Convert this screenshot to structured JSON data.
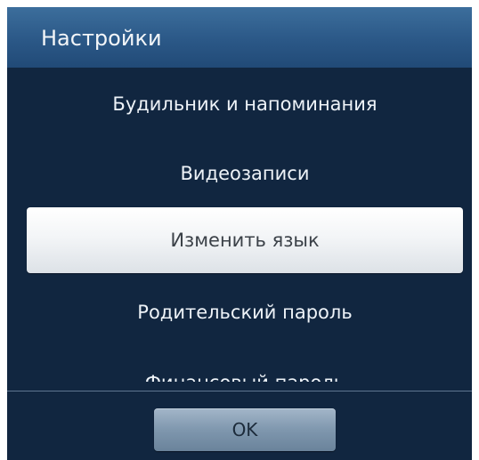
{
  "dialog": {
    "title": "Настройки",
    "items": [
      {
        "label": "Будильник и напоминания",
        "selected": false
      },
      {
        "label": "Видеозаписи",
        "selected": false
      },
      {
        "label": "Изменить язык",
        "selected": true
      },
      {
        "label": "Родительский пароль",
        "selected": false
      },
      {
        "label": "Финансовый пароль",
        "selected": false
      }
    ],
    "ok_label": "OK"
  },
  "colors": {
    "dialog_background": "#112640",
    "header_background": "#2b5887",
    "selected_item_background": "#f3f5f7",
    "ok_button_background": "#7f97ae"
  }
}
